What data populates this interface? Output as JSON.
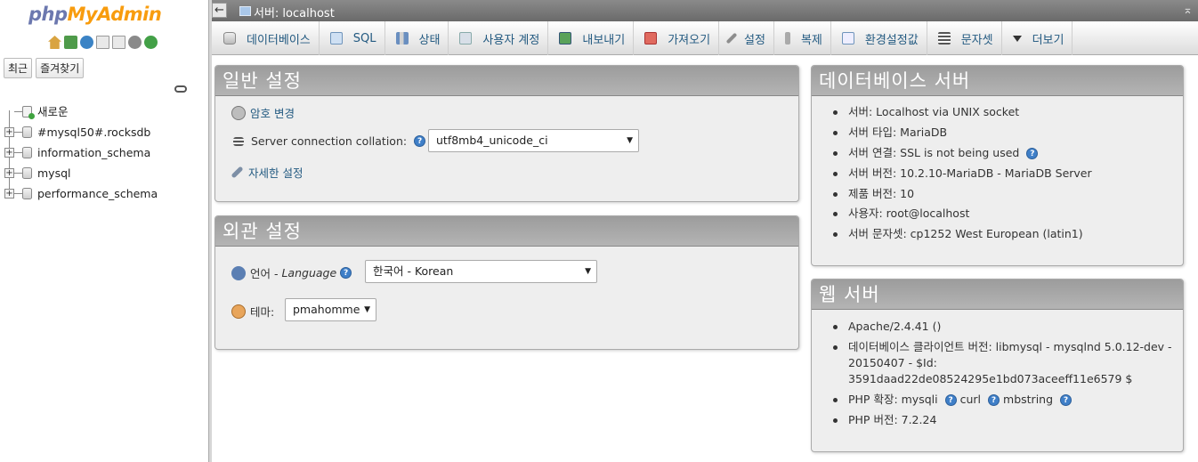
{
  "logo": {
    "php": "php",
    "myadmin": "MyAdmin"
  },
  "nav": {
    "icons": [
      "home-icon",
      "exit-icon",
      "help-icon",
      "docs-icon",
      "docs2-icon",
      "settings-gear-icon",
      "reload-icon"
    ],
    "tabs": {
      "recent": "최근",
      "favorites": "즐겨찾기"
    },
    "tree": [
      {
        "label": "새로운",
        "type": "new"
      },
      {
        "label": "#mysql50#.rocksdb",
        "type": "db"
      },
      {
        "label": "information_schema",
        "type": "db"
      },
      {
        "label": "mysql",
        "type": "db"
      },
      {
        "label": "performance_schema",
        "type": "db"
      }
    ]
  },
  "topbar": {
    "title": "서버: localhost",
    "back": "←",
    "collapse": "⌅"
  },
  "menu": [
    {
      "label": "데이터베이스",
      "icon": "database-icon"
    },
    {
      "label": "SQL",
      "icon": "sql-icon"
    },
    {
      "label": "상태",
      "icon": "status-icon"
    },
    {
      "label": "사용자 계정",
      "icon": "users-icon"
    },
    {
      "label": "내보내기",
      "icon": "export-icon"
    },
    {
      "label": "가져오기",
      "icon": "import-icon"
    },
    {
      "label": "설정",
      "icon": "settings-icon"
    },
    {
      "label": "복제",
      "icon": "replication-icon"
    },
    {
      "label": "환경설정값",
      "icon": "variables-icon"
    },
    {
      "label": "문자셋",
      "icon": "charset-icon"
    },
    {
      "label": "더보기",
      "icon": "more-icon"
    }
  ],
  "general": {
    "title": "일반 설정",
    "change_password": "암호 변경",
    "collation_label": "Server connection collation:",
    "collation_value": "utf8mb4_unicode_ci",
    "more_settings": "자세한 설정"
  },
  "appearance": {
    "title": "외관 설정",
    "language_label": "언어 - ",
    "language_en": "Language",
    "language_value": "한국어 - Korean",
    "theme_label": "테마:",
    "theme_value": "pmahomme"
  },
  "dbserver": {
    "title": "데이터베이스 서버",
    "items": [
      "서버: Localhost via UNIX socket",
      "서버 타입: MariaDB",
      "서버 연결: SSL is not being used",
      "서버 버전: 10.2.10-MariaDB - MariaDB Server",
      "제품 버전: 10",
      "사용자: root@localhost",
      "서버 문자셋: cp1252 West European (latin1)"
    ]
  },
  "webserver": {
    "title": "웹 서버",
    "items": [
      "Apache/2.4.41 ()",
      "데이터베이스 클라이언트 버전: libmysql - mysqlnd 5.0.12-dev - 20150407 - $Id: 3591daad22de08524295e1bd073aceeff11e6579 $",
      "PHP 확장: mysqli",
      "PHP 버전: 7.2.24"
    ],
    "ext_curl": "curl",
    "ext_mbstring": "mbstring"
  },
  "help_glyph": "?"
}
